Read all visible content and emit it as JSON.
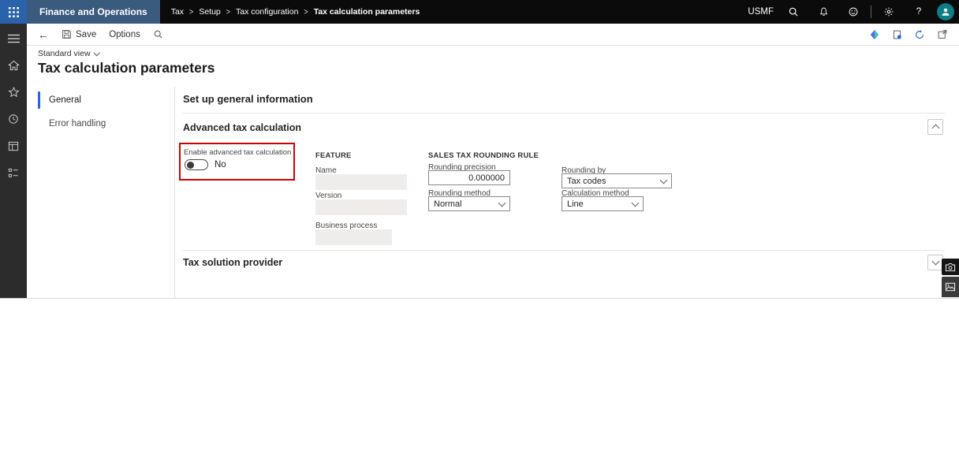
{
  "topbar": {
    "app_name": "Finance and Operations",
    "separator": ">",
    "breadcrumb": [
      "Tax",
      "Setup",
      "Tax configuration",
      "Tax calculation parameters"
    ],
    "company": "USMF",
    "help_label": "?"
  },
  "action_pane": {
    "save_label": "Save",
    "options_label": "Options"
  },
  "page": {
    "view_label": "Standard view",
    "title": "Tax calculation parameters"
  },
  "nav": {
    "items": [
      {
        "label": "General",
        "selected": true
      },
      {
        "label": "Error handling",
        "selected": false
      }
    ]
  },
  "content": {
    "header": "Set up general information",
    "advanced_section": {
      "title": "Advanced tax calculation",
      "toggle_label": "Enable advanced tax calculation",
      "toggle_value": "No",
      "feature_header": "FEATURE",
      "name_label": "Name",
      "name_value": "",
      "version_label": "Version",
      "version_value": "",
      "business_process_label": "Business process",
      "business_process_value": "",
      "rounding_header": "SALES TAX ROUNDING RULE",
      "rounding_precision_label": "Rounding precision",
      "rounding_precision_value": "0.000000",
      "rounding_method_label": "Rounding method",
      "rounding_method_value": "Normal",
      "rounding_by_label": "Rounding by",
      "rounding_by_value": "Tax codes",
      "calculation_method_label": "Calculation method",
      "calculation_method_value": "Line"
    },
    "provider_section": {
      "title": "Tax solution provider"
    }
  },
  "colors": {
    "topbar_bg": "#0b0b0b",
    "waffle_bg": "#2a62ac",
    "app_name_bg": "#3a5a7e",
    "sidebar_bg": "#2c2c2c",
    "accent": "#2266e3",
    "annotation_red": "#d40000",
    "avatar_bg": "#0f7c86"
  }
}
